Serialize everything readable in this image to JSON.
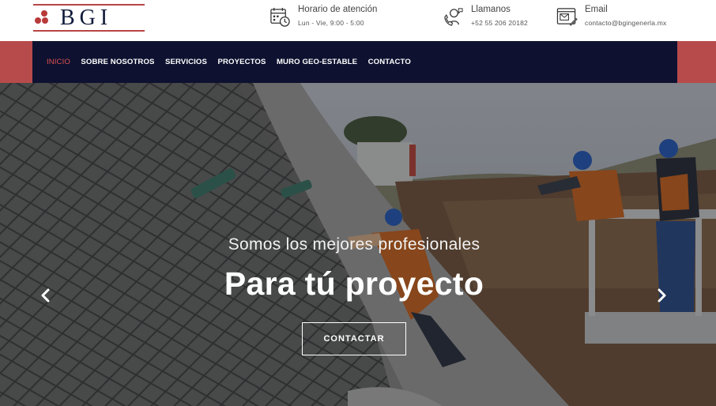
{
  "header": {
    "logo_text": "BGI",
    "hours": {
      "icon": "calendar-clock-icon",
      "label": "Horario de atención",
      "value": "Lun - Vie, 9:00 - 5:00"
    },
    "phone": {
      "icon": "phone-support-icon",
      "label": "Llamanos",
      "value": "+52 55 206 20182"
    },
    "email": {
      "icon": "email-icon",
      "label": "Email",
      "value": "contacto@bgingenerla.mx"
    }
  },
  "nav": {
    "items": [
      {
        "label": "INICIO",
        "active": true
      },
      {
        "label": "SOBRE NOSOTROS",
        "active": false
      },
      {
        "label": "SERVICIOS",
        "active": false
      },
      {
        "label": "PROYECTOS",
        "active": false
      },
      {
        "label": "MURO GEO-ESTABLE",
        "active": false
      },
      {
        "label": "CONTACTO",
        "active": false
      }
    ]
  },
  "hero": {
    "subtitle": "Somos los mejores profesionales",
    "title": "Para tú proyecto",
    "cta_label": "CONTACTAR",
    "prev_icon": "chevron-left-icon",
    "next_icon": "chevron-right-icon"
  },
  "colors": {
    "brand_red": "#b74b4b",
    "nav_navy": "#0e1230",
    "active_nav": "#e05050",
    "logo_navy": "#0f1a3a"
  }
}
